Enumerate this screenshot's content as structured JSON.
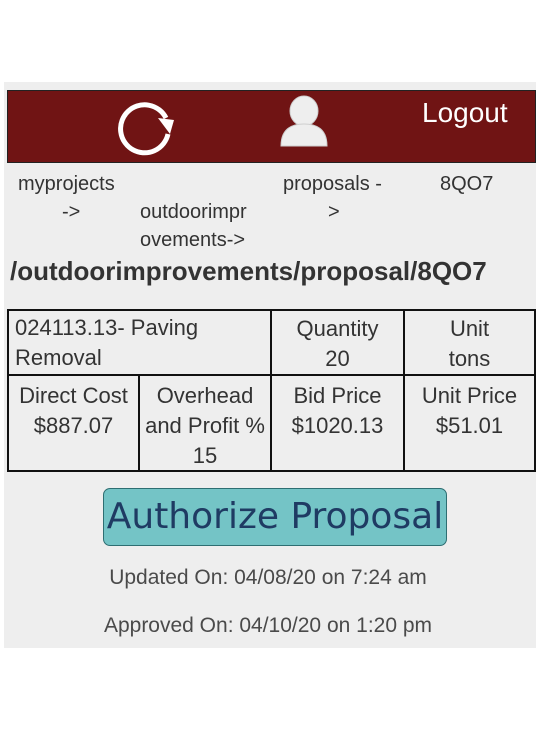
{
  "header": {
    "logout_label": "Logout",
    "refresh_icon": "refresh-icon",
    "user_icon": "user-avatar-icon",
    "bg_color": "#701414"
  },
  "breadcrumbs": {
    "myprojects": "myprojects",
    "myprojects_arrow": "->",
    "outdoor_line1": "outdoorimpr",
    "outdoor_line2": "ovements->",
    "proposals": "proposals -",
    "proposals_arrow": ">",
    "proposal_id": "8QO7"
  },
  "path_title": "/outdoorimprovements/proposal/8QO7",
  "item": {
    "name_line1": "024113.13- Paving",
    "name_line2": "Removal",
    "quantity_label": "Quantity",
    "quantity_value": "20",
    "unit_label": "Unit",
    "unit_value": "tons"
  },
  "costs": {
    "direct_cost_label": "Direct Cost",
    "direct_cost_value": "$887.07",
    "overhead_label_line1": "Overhead",
    "overhead_label_line2": "and Profit %",
    "overhead_value": "15",
    "bid_price_label": "Bid Price",
    "bid_price_value": "$1020.13",
    "unit_price_label": "Unit Price",
    "unit_price_value": "$51.01"
  },
  "actions": {
    "authorize_label": "Authorize Proposal",
    "authorize_color": "#74c4c6"
  },
  "status": {
    "updated": "Updated On: 04/08/20 on 7:24 am",
    "approved": "Approved On: 04/10/20 on 1:20 pm"
  }
}
